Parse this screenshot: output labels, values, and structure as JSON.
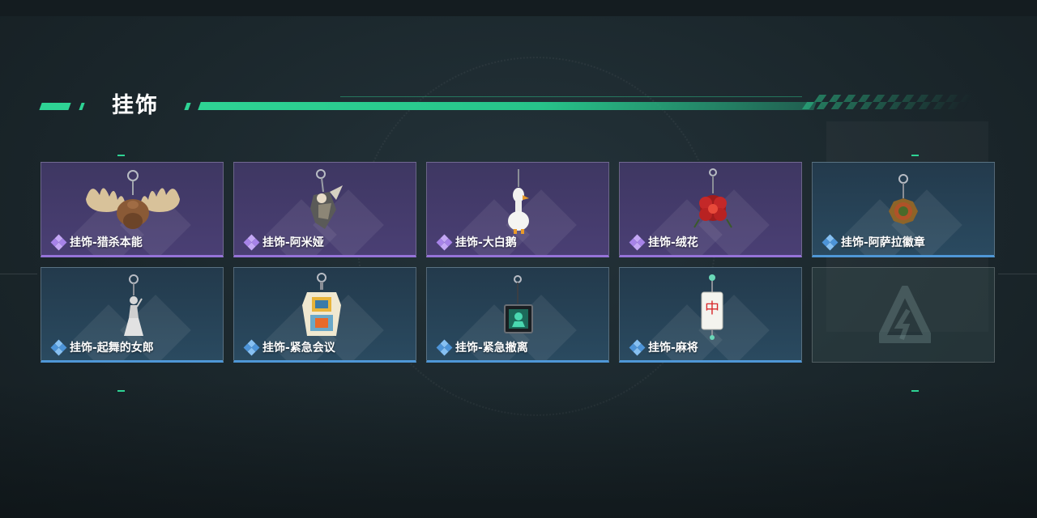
{
  "section": {
    "title": "挂饰"
  },
  "items": [
    {
      "label": "挂饰-猎杀本能",
      "rarity": "purple",
      "icon": "moose-antlers-charm-icon"
    },
    {
      "label": "挂饰-阿米娅",
      "rarity": "purple",
      "icon": "amiya-figure-charm-icon"
    },
    {
      "label": "挂饰-大白鹅",
      "rarity": "purple",
      "icon": "white-goose-charm-icon"
    },
    {
      "label": "挂饰-绒花",
      "rarity": "purple",
      "icon": "velvet-flower-charm-icon"
    },
    {
      "label": "挂饰-阿萨拉徽章",
      "rarity": "blue",
      "icon": "asala-badge-charm-icon"
    },
    {
      "label": "挂饰-起舞的女郎",
      "rarity": "blue",
      "icon": "dancing-lady-charm-icon"
    },
    {
      "label": "挂饰-紧急会议",
      "rarity": "blue",
      "icon": "emergency-meeting-charm-icon"
    },
    {
      "label": "挂饰-紧急撤离",
      "rarity": "blue",
      "icon": "emergency-evacuation-charm-icon"
    },
    {
      "label": "挂饰-麻将",
      "rarity": "blue",
      "icon": "mahjong-tile-charm-icon"
    }
  ],
  "empty_slot": {
    "icon": "delta-logo-icon"
  },
  "colors": {
    "accent": "#2ed394",
    "rarity_purple": "#9573d8",
    "rarity_blue": "#4f97d6"
  }
}
